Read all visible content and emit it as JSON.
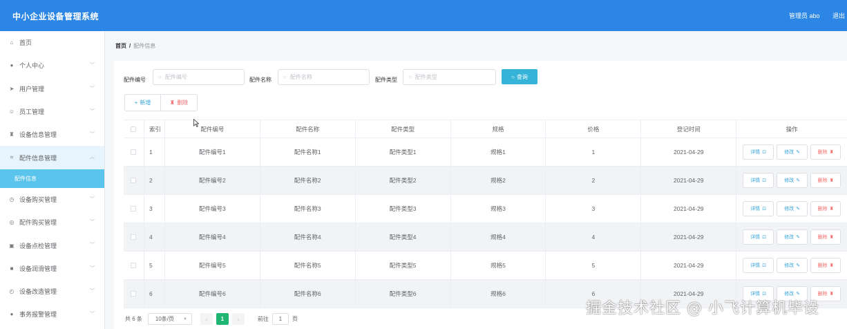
{
  "app": {
    "title": "中小企业设备管理系统",
    "user": "管理员 abo",
    "logout": "退出"
  },
  "colors": {
    "header": "#2b86e6",
    "active_sub": "#5bc4ec",
    "query_button": "#36b3d8",
    "pager_active": "#21b573",
    "danger": "#f56c6c"
  },
  "sidebar": {
    "items": [
      {
        "label": "首页",
        "icon": "home-icon",
        "glyph": "⌂",
        "chevron": false
      },
      {
        "label": "个人中心",
        "icon": "user-icon",
        "glyph": "●",
        "chevron": true
      },
      {
        "label": "用户管理",
        "icon": "send-icon",
        "glyph": "➤",
        "chevron": true
      },
      {
        "label": "员工管理",
        "icon": "smile-icon",
        "glyph": "☺",
        "chevron": true
      },
      {
        "label": "设备信息管理",
        "icon": "lamp-icon",
        "glyph": "♜",
        "chevron": true
      },
      {
        "label": "配件信息管理",
        "icon": "crop-icon",
        "glyph": "⌗",
        "chevron": true,
        "open": true
      },
      {
        "label": "设备购买管理",
        "icon": "clock-icon",
        "glyph": "◷",
        "chevron": true
      },
      {
        "label": "配件购买管理",
        "icon": "target-icon",
        "glyph": "◎",
        "chevron": true
      },
      {
        "label": "设备点检管理",
        "icon": "suitcase-icon",
        "glyph": "▣",
        "chevron": true
      },
      {
        "label": "设备润滑管理",
        "icon": "tablet-icon",
        "glyph": "■",
        "chevron": true
      },
      {
        "label": "设备改造管理",
        "icon": "power-icon",
        "glyph": "◴",
        "chevron": true
      },
      {
        "label": "事务报警管理",
        "icon": "person-icon",
        "glyph": "●",
        "chevron": true
      }
    ],
    "submenu_label": "配件信息"
  },
  "breadcrumb": {
    "home": "首页",
    "separator": "/",
    "current": "配件信息"
  },
  "search": {
    "code_label": "配件编号",
    "code_placeholder": "配件编号",
    "name_label": "配件名称",
    "name_placeholder": "配件名称",
    "type_label": "配件类型",
    "type_placeholder": "配件类型",
    "query_label": "查询"
  },
  "actions": {
    "add": "新增",
    "delete": "删除"
  },
  "table": {
    "headers": [
      "索引",
      "配件编号",
      "配件名称",
      "配件类型",
      "规格",
      "价格",
      "登记时间",
      "操作"
    ],
    "rows": [
      {
        "idx": "1",
        "code": "配件编号1",
        "name": "配件名称1",
        "type": "配件类型1",
        "spec": "规格1",
        "price": "1",
        "date": "2021-04-29"
      },
      {
        "idx": "2",
        "code": "配件编号2",
        "name": "配件名称2",
        "type": "配件类型2",
        "spec": "规格2",
        "price": "2",
        "date": "2021-04-29"
      },
      {
        "idx": "3",
        "code": "配件编号3",
        "name": "配件名称3",
        "type": "配件类型3",
        "spec": "规格3",
        "price": "3",
        "date": "2021-04-29"
      },
      {
        "idx": "4",
        "code": "配件编号4",
        "name": "配件名称4",
        "type": "配件类型4",
        "spec": "规格4",
        "price": "4",
        "date": "2021-04-29"
      },
      {
        "idx": "5",
        "code": "配件编号5",
        "name": "配件名称5",
        "type": "配件类型5",
        "spec": "规格5",
        "price": "5",
        "date": "2021-04-29"
      },
      {
        "idx": "6",
        "code": "配件编号6",
        "name": "配件名称6",
        "type": "配件类型6",
        "spec": "规格6",
        "price": "6",
        "date": "2021-04-29"
      }
    ],
    "op_detail": "详情",
    "op_edit": "修改",
    "op_delete": "删除"
  },
  "pager": {
    "total": "共 6 条",
    "page_size": "10条/页",
    "current_page": "1",
    "goto_label": "前往",
    "goto_value": "1",
    "goto_unit": "页"
  },
  "watermark": "掘金技术社区 @ 小飞计算机毕设"
}
